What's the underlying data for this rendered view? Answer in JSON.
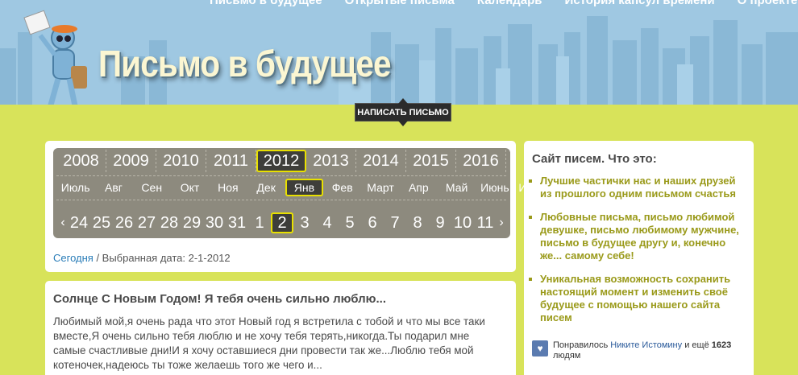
{
  "topnav": [
    "Письмо в будущее",
    "Открытые письма",
    "Календарь",
    "История капсул времени",
    "О проекте"
  ],
  "site_title": "Письмо в будущее",
  "write_button": "НАПИСАТЬ ПИСЬМО",
  "calendar": {
    "years": [
      "2008",
      "2009",
      "2010",
      "2011",
      "2012",
      "2013",
      "2014",
      "2015",
      "2016"
    ],
    "selected_year": "2012",
    "months": [
      "Июль",
      "Авг",
      "Сен",
      "Окт",
      "Ноя",
      "Дек",
      "Янв",
      "Фев",
      "Март",
      "Апр",
      "Май",
      "Июнь",
      "Июль"
    ],
    "selected_month": "Янв",
    "days": [
      "24",
      "25",
      "26",
      "27",
      "28",
      "29",
      "30",
      "31",
      "1",
      "2",
      "3",
      "4",
      "5",
      "6",
      "7",
      "8",
      "9",
      "10",
      "11"
    ],
    "selected_day": "2",
    "prev_arrow": "‹",
    "next_arrow": "›",
    "today_link": "Сегодня",
    "selected_date_label": " / Выбранная дата: 2-1-2012"
  },
  "letter": {
    "title": "Солнце С Новым Годом! Я тебя очень сильно люблю...",
    "text": "Любимый мой,я очень рада что этот Новый год я встретила с тобой и что мы все таки вместе,Я очень сильно тебя люблю и не хочу тебя терять,никогда.Ты подарил мне самые счастливые дни!И я хочу оставшиеся дни провести так же...Люблю тебя мой котеночек,надеюсь ты тоже желаешь того же чего и..."
  },
  "sidebar": {
    "title": "Сайт писем. Что это:",
    "items": [
      "Лучшие частички нас и наших друзей из прошлого одним письмом счастья",
      "Любовные письма, письмо любимой девушке, письмо любимому мужчине, письмо в будущее другу и, конечно же... самому себе!",
      "Уникальная возможность сохранить настоящий момент и изменить своё будущее с помощью нашего сайта писем"
    ],
    "like": {
      "prefix": "Понравилось ",
      "name": "Никите Истомину",
      "middle": " и ещё ",
      "count": "1623",
      "suffix": "людям"
    }
  },
  "colors": {
    "background": "#d8e35a",
    "sky": "#9fc8e2",
    "calendar_panel": "#8d8a7e",
    "highlight": "#e8e000",
    "sidebar_text": "#9a9a1a"
  }
}
